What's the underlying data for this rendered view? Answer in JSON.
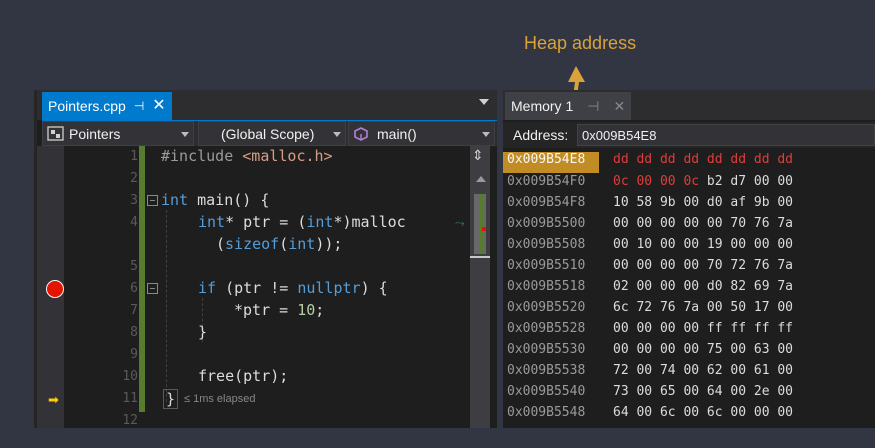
{
  "callout": {
    "text": "Heap address",
    "color": "#d9a23b"
  },
  "editor": {
    "tab_title": "Pointers.cpp",
    "tab_pin": "⊣",
    "tab_close": "✕",
    "nav_project": "Pointers",
    "nav_scope": "(Global Scope)",
    "nav_member": "main()",
    "line_numbers": [
      "1",
      "2",
      "3",
      "4",
      "",
      "5",
      "6",
      "7",
      "8",
      "9",
      "10",
      "11",
      "12"
    ],
    "code": {
      "l1_pp": "#include ",
      "l1_str": "<malloc.h>",
      "l3_kw": "int",
      "l3_rest": " main() {",
      "l4_a": "int",
      "l4_b": "* ptr = (",
      "l4_c": "int",
      "l4_d": "*)malloc",
      "l4w_kw": "sizeof",
      "l4w_a": "(",
      "l4w_b": "int",
      "l4w_c": "));",
      "l6_kw": "if",
      "l6_a": " (ptr != ",
      "l6_b": "nullptr",
      "l6_c": ") {",
      "l7_a": "*ptr = ",
      "l7_num": "10",
      "l7_b": ";",
      "l8": "}",
      "l10": "free(ptr);",
      "l11": "}"
    },
    "elapsed": "≤ 1ms elapsed",
    "breakpoint_color": "#e51400",
    "ip_color": "#ffcc00"
  },
  "memory": {
    "tab_title": "Memory 1",
    "tab_pin": "⊣",
    "tab_close": "✕",
    "address_label": "Address:",
    "address_value": "0x009B54E8",
    "rows": [
      {
        "addr": "0x009B54E8",
        "bytes": "dd dd dd dd dd dd dd dd"
      },
      {
        "addr": "0x009B54F0",
        "bytes_red": "0c 00 00 0c",
        "bytes": " b2 d7 00 00"
      },
      {
        "addr": "0x009B54F8",
        "bytes": "10 58 9b 00 d0 af 9b 00"
      },
      {
        "addr": "0x009B5500",
        "bytes": "00 00 00 00 00 70 76 7a"
      },
      {
        "addr": "0x009B5508",
        "bytes": "00 10 00 00 19 00 00 00"
      },
      {
        "addr": "0x009B5510",
        "bytes": "00 00 00 00 70 72 76 7a"
      },
      {
        "addr": "0x009B5518",
        "bytes": "02 00 00 00 d0 82 69 7a"
      },
      {
        "addr": "0x009B5520",
        "bytes": "6c 72 76 7a 00 50 17 00"
      },
      {
        "addr": "0x009B5528",
        "bytes": "00 00 00 00 ff ff ff ff"
      },
      {
        "addr": "0x009B5530",
        "bytes": "00 00 00 00 75 00 63 00"
      },
      {
        "addr": "0x009B5538",
        "bytes": "72 00 74 00 62 00 61 00"
      },
      {
        "addr": "0x009B5540",
        "bytes": "73 00 65 00 64 00 2e 00"
      },
      {
        "addr": "0x009B5548",
        "bytes": "64 00 6c 00 6c 00 00 00"
      }
    ],
    "highlight_color": "#c28c25",
    "changed_color": "#e03c3c"
  }
}
